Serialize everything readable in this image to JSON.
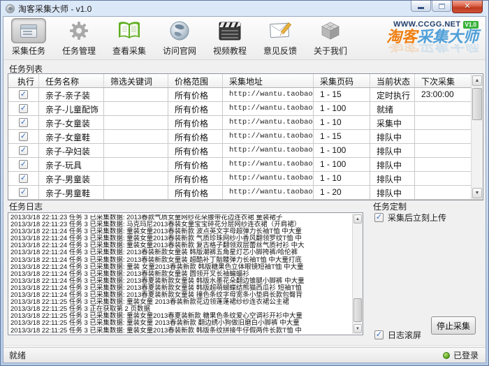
{
  "window": {
    "title": "淘客采集大师 - v1.0",
    "status_left": "就绪",
    "status_right": "已登录"
  },
  "toolbar": {
    "buttons": [
      {
        "label": "采集任务",
        "icon": "collect-task-icon",
        "active": true
      },
      {
        "label": "任务管理",
        "icon": "gear-icon",
        "active": false
      },
      {
        "label": "查看采集",
        "icon": "book-icon",
        "active": false
      },
      {
        "label": "访问官网",
        "icon": "globe-icon",
        "active": false
      },
      {
        "label": "视频教程",
        "icon": "clapperboard-icon",
        "active": false
      },
      {
        "label": "意见反馈",
        "icon": "feedback-pencil-icon",
        "active": false
      },
      {
        "label": "关于我们",
        "icon": "cube-icon",
        "active": false
      }
    ],
    "logo": {
      "site": "WWW.CCGG.NET",
      "badge": "V1.0",
      "brand_orange": "淘客",
      "brand_blue": "采集大师"
    }
  },
  "task_list": {
    "section_label": "任务列表",
    "columns": [
      "执行",
      "任务名称",
      "筛选关键词",
      "价格范围",
      "采集地址",
      "采集页码",
      "当前状态",
      "下次采集"
    ],
    "rows": [
      {
        "checked": true,
        "name": "亲子-亲子装",
        "keyword": "",
        "price": "所有价格",
        "url": "http://wantu.taobao...",
        "pages": "1 - 15",
        "status": "定时执行",
        "next": "23:00:00"
      },
      {
        "checked": true,
        "name": "亲子-儿童配饰",
        "keyword": "",
        "price": "所有价格",
        "url": "http://wantu.taobao...",
        "pages": "1 - 100",
        "status": "就绪",
        "next": ""
      },
      {
        "checked": true,
        "name": "亲子-女童装",
        "keyword": "",
        "price": "所有价格",
        "url": "http://wantu.taobao...",
        "pages": "1 - 10",
        "status": "采集中",
        "next": ""
      },
      {
        "checked": true,
        "name": "亲子-女童鞋",
        "keyword": "",
        "price": "所有价格",
        "url": "http://wantu.taobao...",
        "pages": "1 - 15",
        "status": "排队中",
        "next": ""
      },
      {
        "checked": true,
        "name": "亲子-孕妇装",
        "keyword": "",
        "price": "所有价格",
        "url": "http://wantu.taobao...",
        "pages": "1 - 100",
        "status": "排队中",
        "next": ""
      },
      {
        "checked": true,
        "name": "亲子-玩具",
        "keyword": "",
        "price": "所有价格",
        "url": "http://wantu.taobao...",
        "pages": "1 - 100",
        "status": "排队中",
        "next": ""
      },
      {
        "checked": true,
        "name": "亲子-男童装",
        "keyword": "",
        "price": "所有价格",
        "url": "http://wantu.taobao...",
        "pages": "1 - 10",
        "status": "排队中",
        "next": ""
      },
      {
        "checked": true,
        "name": "亲子-男童鞋",
        "keyword": "",
        "price": "所有价格",
        "url": "http://wantu.taobao...",
        "pages": "1 - 20",
        "status": "排队中",
        "next": ""
      }
    ]
  },
  "task_log": {
    "section_label": "任务日志",
    "lines": [
      "2013/3/18 22:11:23 任务 3 已采集数据: 2013春款气质女童网纱花朵腰带花边连衣裙 童装裙子",
      "2013/3/18 22:11:23 任务 3 已采集数据: 马克玛尼2013春装女童宝宝碎花分层网纱连衣裙（开肩裙）",
      "2013/3/18 22:11:24 任务 3 已采集数据: 童装女童2013春装新款 波点英文字母超弹力长袖T恤 中大童",
      "2013/3/18 22:11:24 任务 3 已采集数据: 童装女童2013春装新款 气质珍珠网纱小香风翻领罗纹T恤 中",
      "2013/3/18 22:11:24 任务 3 已采集数据: 童装女童2013春装新款 复古格子翻领双层蕾丝气质衬衫 中大",
      "2013/3/18 22:11:24 任务 3 已采集数据: 2013春装新款女童装 韩版潮裤五角星灯芯小脚挎裤/哈伦裤",
      "2013/3/18 22:11:24 任务 3 已采集数据: 2013春装新款女童装 超酷补丁骷髅弹力长袖T恤 中大童打底",
      "2013/3/18 22:11:24 任务 3 已采集数据: 童装 女童2013春装新款 韩版糖果色立体眼镜短袖T恤 中大童",
      "2013/3/18 22:11:24 任务 3 已采集数据: 2013春装新款女童装 圆领开叉长袖蝙蝠衫",
      "2013/3/18 22:11:24 任务 3 已采集数据: 2013春夏装新款女童装 韩版水墨花朵翻边锥腿小脚裤 中大童",
      "2013/3/18 22:11:24 任务 3 已采集数据: 2013春夏装新款女童装 韩版超萌蝴蝶结熊猫西瓜衫 短袖T恤",
      "2013/3/18 22:11:24 任务 3 已采集数据: 2013春夏装新款女童装 撞色条纹字母宽条小垫肩长款包臀背",
      "2013/3/18 22:11:25 任务 3 已采集数据: 童装女童 2013春装新款花边领蓬蓬裙纱纱连衣裙公主裙",
      "2013/3/18 22:11:25 任务 3 正在获取第 2 页数据",
      "2013/3/18 22:11:25 任务 3 已采集数据: 童装女童2013春夏装新款 糖果色条纹爱心空调衫开衫中大童",
      "2013/3/18 22:11:25 任务 3 已采集数据: 童装女童 2013春装新款 翻边绣小狗做旧磨白小脚裤 中大童",
      "2013/3/18 22:11:25 任务 3 已采集数据: 童装女童2013春装新款 韩版条纹拼接牛仔假两件长款T恤 中"
    ]
  },
  "task_custom": {
    "section_label": "任务定制",
    "upload_label": "采集后立刻上传",
    "upload_checked": true,
    "scroll_label": "日志滚屏",
    "scroll_checked": true,
    "stop_button": "停止采集"
  },
  "icons": {
    "check": "✓",
    "arrow_up": "▲",
    "arrow_down": "▼",
    "close_glyph": "✕"
  },
  "colors": {
    "brand_orange": "#f07f10",
    "brand_blue": "#4f9fd8",
    "badge_green": "#38b23a",
    "logged_in_green": "#5aa31d",
    "check_blue": "#3a6fc4"
  }
}
